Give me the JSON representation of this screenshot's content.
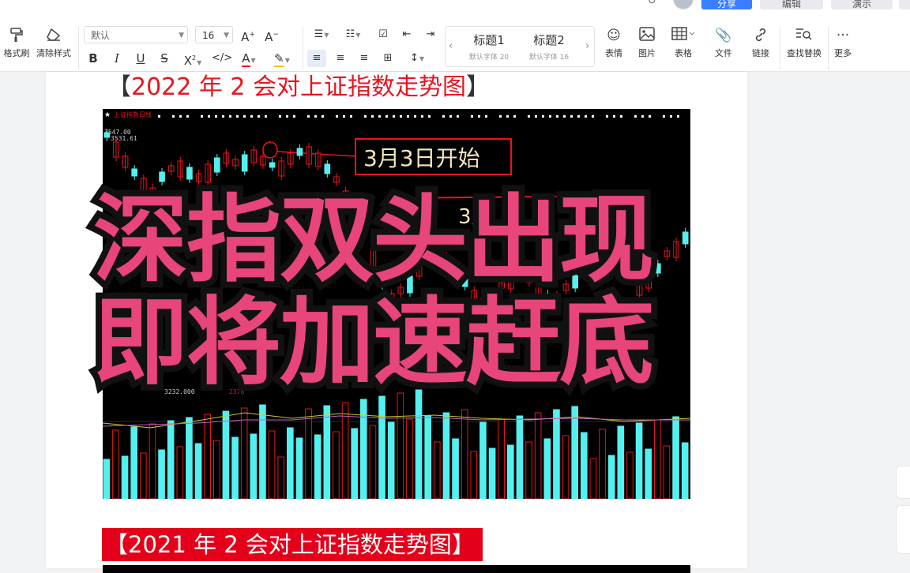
{
  "topbar": {
    "share": "分享",
    "edit": "编辑",
    "present": "演示"
  },
  "toolbar": {
    "format_painter": "格式刷",
    "clear_format": "清除样式",
    "font_name": "默认",
    "font_size": "16",
    "styles": [
      {
        "title": "标题1",
        "sub": "默认字体 20"
      },
      {
        "title": "标题2",
        "sub": "默认字体 16"
      }
    ],
    "insert": [
      "表情",
      "图片",
      "表格",
      "文件",
      "链接"
    ],
    "find_replace": "查找替换",
    "more": "更多"
  },
  "doc": {
    "heading1_open": "【",
    "heading1_text": "2022 年 2 会对上证指数走势图",
    "heading1_close": "】",
    "heading2": "【2021 年 2 会对上证指数走势图】"
  },
  "chart": {
    "name": "上证指数日线",
    "price_high": "3547.00",
    "price_mark": "3531.61",
    "annotation1": "3月3日开始",
    "annotation2": "3月",
    "bottom_left": "3232.000",
    "bottom_mid": "2378"
  },
  "overlay": {
    "line1": "深指双头出现",
    "line2": "即将加速赶底"
  }
}
